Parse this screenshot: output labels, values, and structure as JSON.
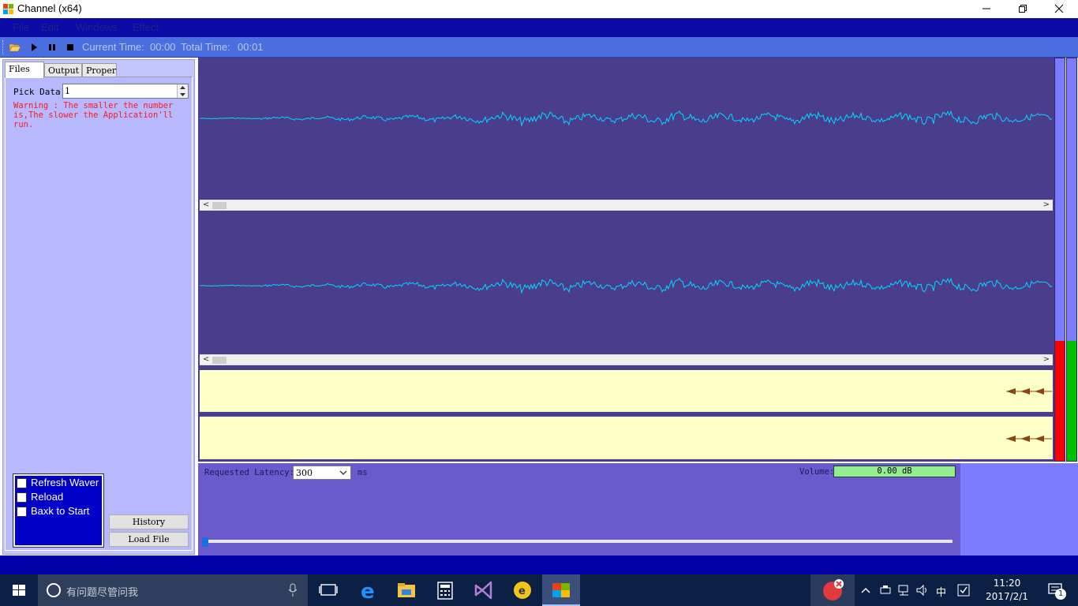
{
  "window": {
    "title": "Channel (x64)"
  },
  "menu": {
    "items": [
      "File",
      "Edit",
      "Windows",
      "Effect"
    ]
  },
  "toolbar": {
    "current_time_label": "Current Time:",
    "current_time": "00:00",
    "total_time_label": "Total Time:",
    "total_time": "00:01"
  },
  "left_panel": {
    "tabs": [
      "Files",
      "Output",
      "Proper"
    ],
    "active_tab": "Files",
    "pick_data_label": "Pick Data",
    "pick_data_value": "1",
    "warning": "Warning : The smaller the number is,The slower the Application'll run.",
    "checkboxes": [
      "Refresh Waver",
      "Reload",
      "Baxk to Start"
    ],
    "history_button": "History",
    "load_file_button": "Load File"
  },
  "controls": {
    "latency_label": "Requested Latency:",
    "latency_value": "300",
    "latency_unit": "ms",
    "volume_label": "Volume:",
    "volume_value": "0.00 dB",
    "position_fraction": 0.0
  },
  "meters": {
    "left_color": "#ff0000",
    "right_color": "#00c000",
    "bg_color": "#7b7bff"
  },
  "colors": {
    "wave_bg": "#4a3d8c",
    "wave_line": "#00d8ff",
    "track_bg": "#ffffc8",
    "menubar": "#0a0aa6",
    "toolbar": "#4a6ee0"
  },
  "taskbar": {
    "search_placeholder": "有问题尽管问我",
    "ime": "中",
    "time": "11:20",
    "date": "2017/2/1",
    "notification_count": "1"
  }
}
